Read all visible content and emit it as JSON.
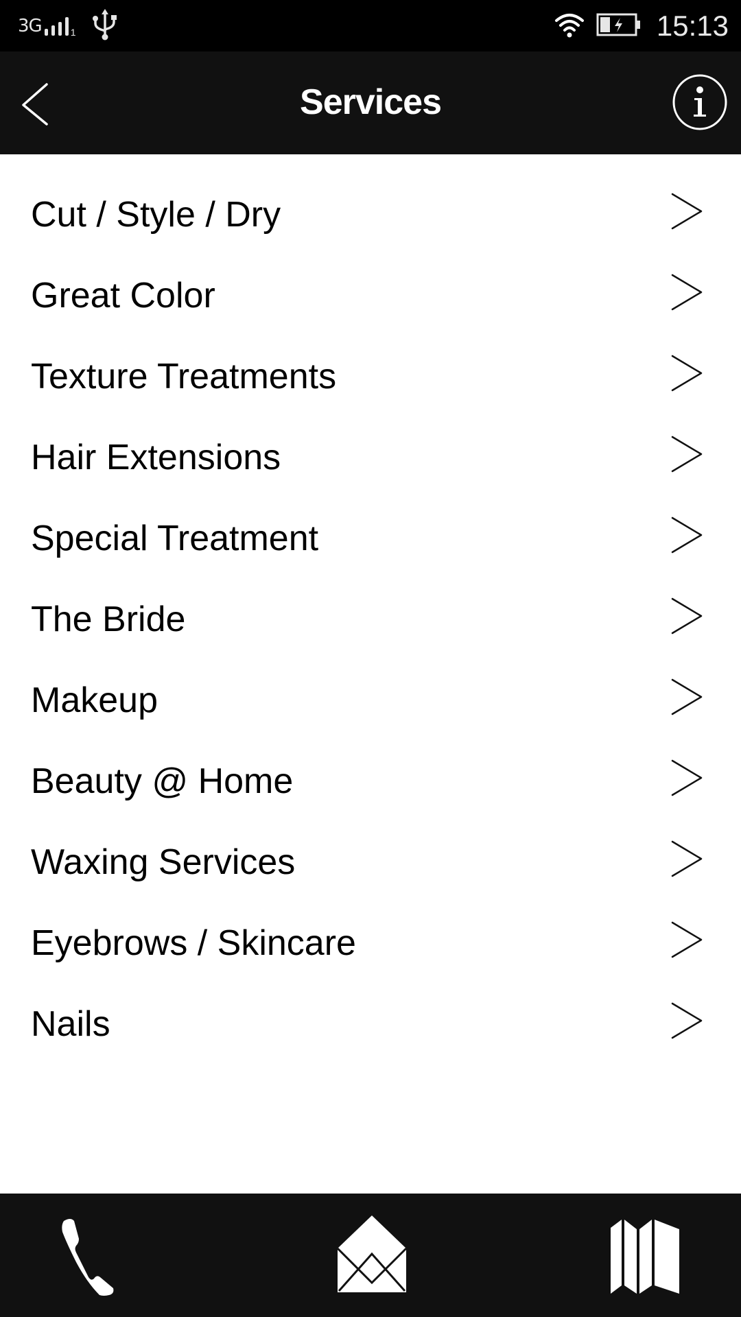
{
  "status_bar": {
    "network": "3G",
    "sim_slot": "1",
    "time": "15:13",
    "icons": [
      "signal-icon",
      "usb-icon",
      "wifi-icon",
      "battery-charging-icon"
    ]
  },
  "app_bar": {
    "title": "Services",
    "back_icon": "chevron-left-icon",
    "info_icon": "info-icon"
  },
  "services": {
    "items": [
      {
        "label": "Cut / Style / Dry"
      },
      {
        "label": "Great Color"
      },
      {
        "label": "Texture Treatments"
      },
      {
        "label": "Hair Extensions"
      },
      {
        "label": "Special Treatment"
      },
      {
        "label": "The Bride"
      },
      {
        "label": "Makeup"
      },
      {
        "label": "Beauty @ Home"
      },
      {
        "label": "Waxing Services"
      },
      {
        "label": "Eyebrows / Skincare"
      },
      {
        "label": "Nails"
      }
    ],
    "item_icon": "chevron-right-icon"
  },
  "bottom_bar": {
    "buttons": [
      {
        "icon": "phone-icon"
      },
      {
        "icon": "mail-icon"
      },
      {
        "icon": "map-icon"
      }
    ]
  },
  "colors": {
    "status_bar_bg": "#000000",
    "app_bar_bg": "#111111",
    "content_bg": "#ffffff",
    "text": "#000000",
    "icon_light": "#ffffff"
  }
}
